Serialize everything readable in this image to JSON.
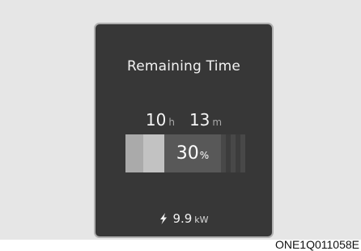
{
  "screen": {
    "title": "Remaining Time",
    "time": {
      "hours": "10",
      "hours_unit": "h",
      "minutes": "13",
      "minutes_unit": "m"
    },
    "battery": {
      "percent": "30",
      "percent_unit": "%",
      "level_fraction": 0.3
    },
    "power": {
      "icon": "lightning-bolt-icon",
      "value": "9.9",
      "unit": "kW"
    }
  },
  "caption": "ONE1Q011058E",
  "colors": {
    "screen_background": "#373737",
    "bar_charged": "#c2c2c2",
    "bar_current": "#585858",
    "text": "#f2f2f2"
  }
}
